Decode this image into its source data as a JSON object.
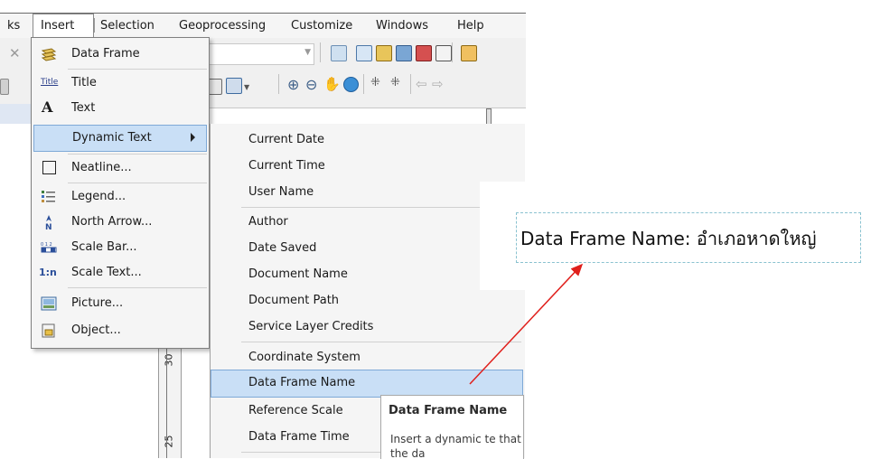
{
  "menubar": {
    "items": [
      {
        "label": "ks"
      },
      {
        "label": "Insert"
      },
      {
        "label": "Selection"
      },
      {
        "label": "Geoprocessing"
      },
      {
        "label": "Customize"
      },
      {
        "label": "Windows"
      },
      {
        "label": "Help"
      }
    ]
  },
  "insert_menu": {
    "items": [
      {
        "label": "Data Frame",
        "icon": "data-frame-icon"
      },
      {
        "label": "Title",
        "icon": "title-icon",
        "icon_text": "Title"
      },
      {
        "label": "Text",
        "icon": "text-icon",
        "icon_text": "A"
      },
      {
        "label": "Dynamic Text",
        "icon": "",
        "highlighted": true,
        "has_submenu": true
      },
      {
        "label": "Neatline...",
        "icon": "neatline-icon"
      },
      {
        "label": "Legend...",
        "icon": "legend-icon"
      },
      {
        "label": "North Arrow...",
        "icon": "north-arrow-icon",
        "icon_text": "N"
      },
      {
        "label": "Scale Bar...",
        "icon": "scale-bar-icon"
      },
      {
        "label": "Scale Text...",
        "icon": "scale-text-icon",
        "icon_text": "1:n"
      },
      {
        "label": "Picture...",
        "icon": "picture-icon"
      },
      {
        "label": "Object...",
        "icon": "object-icon"
      }
    ]
  },
  "dynamic_text_menu": {
    "items": [
      {
        "label": "Current Date"
      },
      {
        "label": "Current Time"
      },
      {
        "label": "User Name"
      },
      {
        "label": "Author"
      },
      {
        "label": "Date Saved"
      },
      {
        "label": "Document Name"
      },
      {
        "label": "Document Path"
      },
      {
        "label": "Service Layer Credits"
      },
      {
        "label": "Coordinate System"
      },
      {
        "label": "Data Frame Name",
        "highlighted": true
      },
      {
        "label": "Reference Scale"
      },
      {
        "label": "Data Frame Time"
      }
    ]
  },
  "tooltip": {
    "title": "Data Frame Name",
    "body": "Insert a dynamic te that displays the da"
  },
  "annotation": {
    "text": "Data Frame Name: อำเภอหาดใหญ่",
    "arrow_color": "#e0201c"
  },
  "ruler": {
    "labels": [
      "30",
      "25"
    ]
  },
  "colors": {
    "highlight": "#c9dff6",
    "highlight_border": "#7ea9d7",
    "menu_bg": "#f5f5f5"
  }
}
